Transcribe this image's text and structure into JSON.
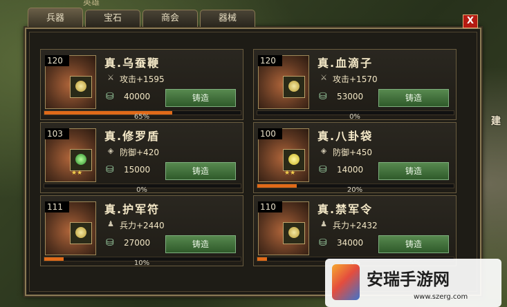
{
  "background": {
    "top_label": "英雄",
    "side_text": "建"
  },
  "tabs": [
    {
      "label": "兵器",
      "active": true
    },
    {
      "label": "宝石",
      "active": false
    },
    {
      "label": "商会",
      "active": false
    },
    {
      "label": "器械",
      "active": false
    }
  ],
  "close_label": "X",
  "items": [
    {
      "level": "120",
      "name": "真.乌蚕鞭",
      "stat_icon": "sword-icon",
      "stat": "攻击+1595",
      "cost": "40000",
      "button": "铸造",
      "progress": 65,
      "progress_label": "65%",
      "gem": "gold"
    },
    {
      "level": "120",
      "name": "真.血滴子",
      "stat_icon": "sword-icon",
      "stat": "攻击+1570",
      "cost": "53000",
      "button": "铸造",
      "progress": 0,
      "progress_label": "0%",
      "gem": "gold"
    },
    {
      "level": "103",
      "name": "真.修罗盾",
      "stat_icon": "shield-icon",
      "stat": "防御+420",
      "cost": "15000",
      "button": "铸造",
      "progress": 0,
      "progress_label": "0%",
      "gem": "green",
      "stars": "★★"
    },
    {
      "level": "100",
      "name": "真.八卦袋",
      "stat_icon": "shield-icon",
      "stat": "防御+450",
      "cost": "14000",
      "button": "铸造",
      "progress": 20,
      "progress_label": "20%",
      "gem": "yellow",
      "stars": "★★"
    },
    {
      "level": "111",
      "name": "真.护军符",
      "stat_icon": "soldier-icon",
      "stat": "兵力+2440",
      "cost": "27000",
      "button": "铸造",
      "progress": 10,
      "progress_label": "10%",
      "gem": "gold"
    },
    {
      "level": "110",
      "name": "真.禁军令",
      "stat_icon": "soldier-icon",
      "stat": "兵力+2432",
      "cost": "34000",
      "button": "铸造",
      "progress": 5,
      "progress_label": "5%",
      "gem": "gold"
    }
  ],
  "watermark": {
    "title": "安瑞手游网",
    "url": "www.szerg.com"
  }
}
